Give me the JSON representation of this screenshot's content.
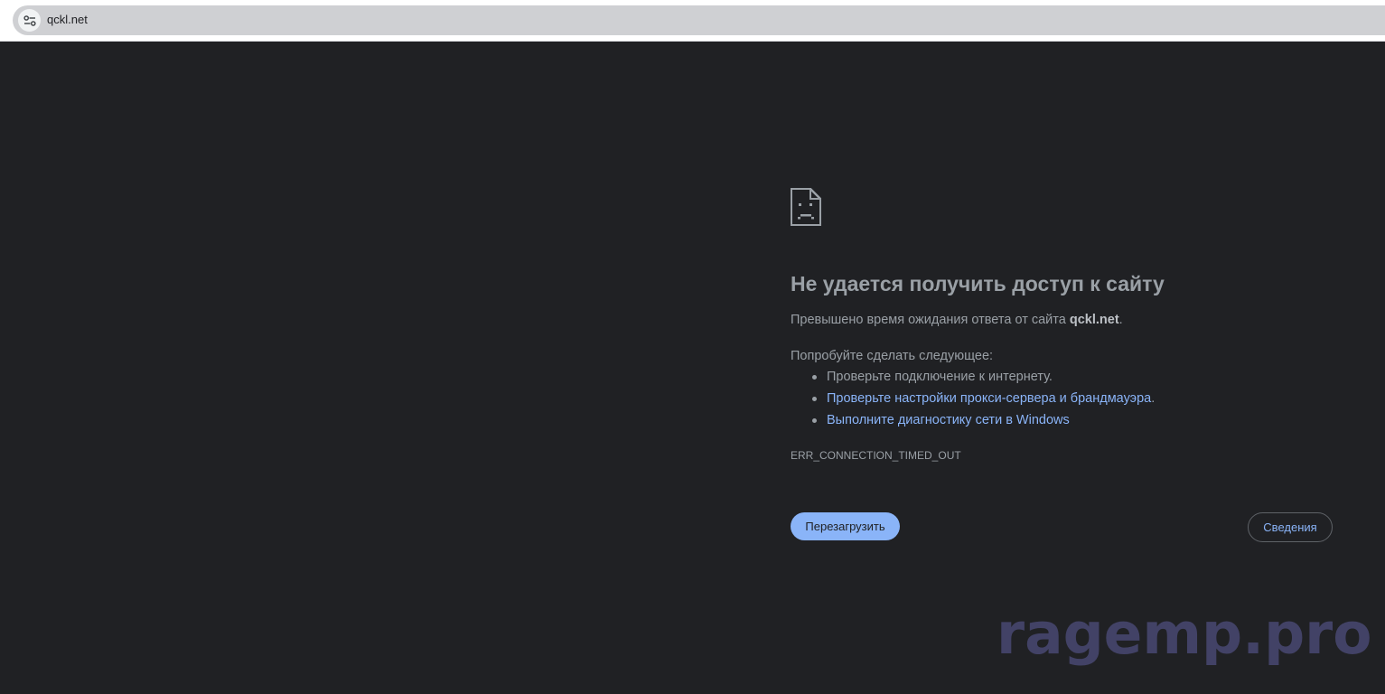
{
  "address_bar": {
    "url": "qckl.net",
    "site_info_icon": "tune-icon"
  },
  "error_page": {
    "icon": "sad-page-icon",
    "heading": "Не удается получить доступ к сайту",
    "summary_prefix": "Превышено время ожидания ответа от сайта ",
    "summary_host": "qckl.net",
    "summary_suffix": ".",
    "suggestions_heading": "Попробуйте сделать следующее:",
    "suggestions": [
      {
        "text": "Проверьте подключение к интернету.",
        "link": "",
        "suffix": ""
      },
      {
        "text": "",
        "link": "Проверьте настройки прокси-сервера и брандмауэра",
        "suffix": "."
      },
      {
        "text": "",
        "link": "Выполните диагностику сети в Windows",
        "suffix": ""
      }
    ],
    "error_code": "ERR_CONNECTION_TIMED_OUT",
    "reload_label": "Перезагрузить",
    "details_label": "Сведения"
  },
  "watermark": "ragemp.pro",
  "colors": {
    "background": "#202124",
    "text": "#9aa0a6",
    "link": "#8ab4f8",
    "reload_button": "#8ab4f8",
    "watermark": "#44446a"
  }
}
